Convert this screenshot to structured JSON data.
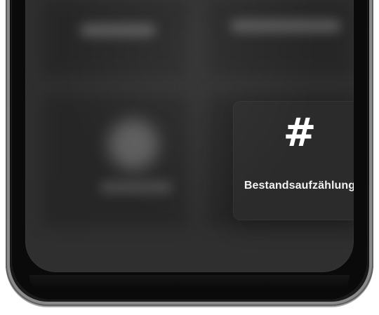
{
  "tiles": {
    "focused": {
      "icon": "#",
      "label": "Bestandsaufzählung"
    }
  }
}
